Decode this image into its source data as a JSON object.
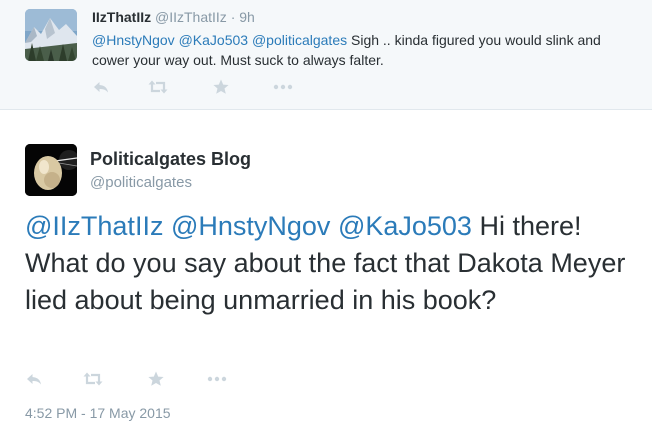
{
  "parent_tweet": {
    "name": "IIzThatIIz",
    "handle": "@IIzThatIIz",
    "time": "· 9h",
    "mentions": [
      "@HnstyNgov",
      "@KaJo503",
      "@politicalgates"
    ],
    "text": "Sigh .. kinda figured you would slink and cower your way out.  Must suck to always falter.",
    "actions": [
      "reply-icon",
      "retweet-icon",
      "favorite-icon",
      "more-icon"
    ]
  },
  "main_tweet": {
    "name": "Politicalgates Blog",
    "handle": "@politicalgates",
    "mentions": [
      "@IIzThatIIz",
      "@HnstyNgov",
      "@KaJo503"
    ],
    "text": "Hi there! What do you say about the fact that Dakota Meyer lied about being unmarried in his book?",
    "timestamp": "4:52 PM - 17 May 2015",
    "actions": [
      "reply-icon",
      "retweet-icon",
      "favorite-icon",
      "more-icon"
    ]
  },
  "colors": {
    "link": "#2b7bb9",
    "muted": "#8899a6",
    "text": "#292f33",
    "icon": "#ccd6dd",
    "parent_bg": "#f5f8fa"
  }
}
